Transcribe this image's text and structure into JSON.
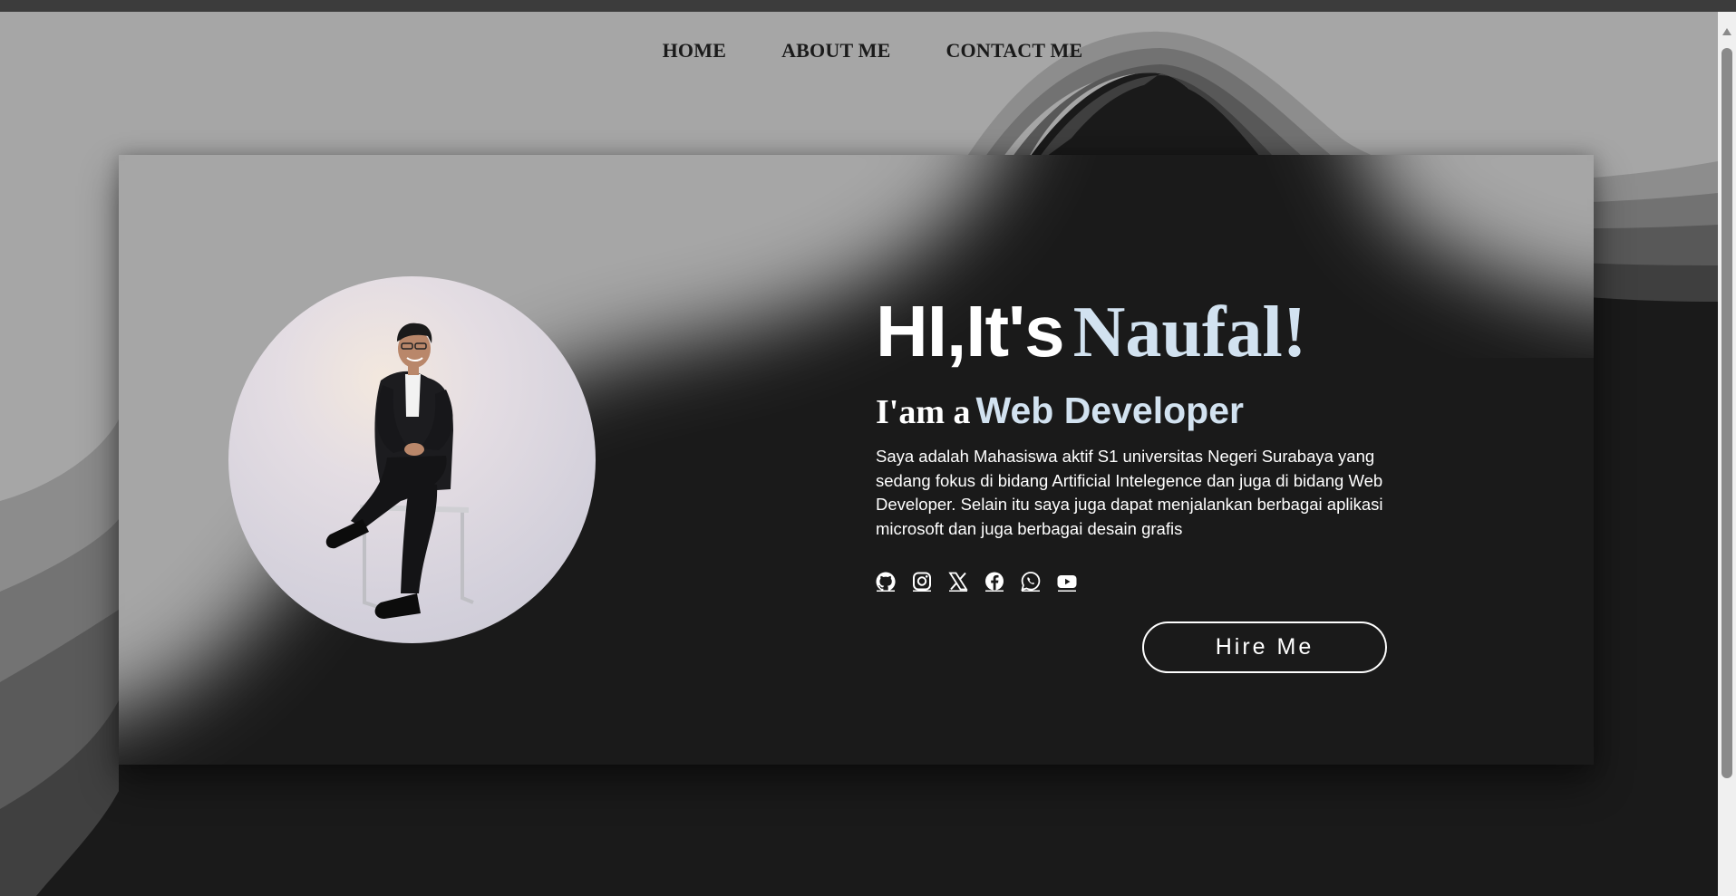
{
  "nav": {
    "items": [
      {
        "label": "HOME"
      },
      {
        "label": "ABOUT ME"
      },
      {
        "label": "CONTACT ME"
      }
    ]
  },
  "hero": {
    "greeting": "HI,It's",
    "name": "Naufal!",
    "iam": "I'am a",
    "role": "Web Developer",
    "description": "Saya adalah Mahasiswa aktif S1 universitas Negeri Surabaya yang sedang fokus di bidang Artificial Intelegence dan juga di bidang Web Developer. Selain itu saya juga dapat menjalankan berbagai aplikasi microsoft dan juga berbagai desain grafis",
    "hire_label": "Hire Me"
  },
  "socials": [
    {
      "icon": "github-icon"
    },
    {
      "icon": "instagram-icon"
    },
    {
      "icon": "x-twitter-icon"
    },
    {
      "icon": "facebook-icon"
    },
    {
      "icon": "whatsapp-icon"
    },
    {
      "icon": "youtube-icon"
    }
  ],
  "colors": {
    "background_dark": "#1a1a1a",
    "background_light": "#a6a6a6",
    "accent_text": "#d2e2f0",
    "text": "#ffffff"
  }
}
